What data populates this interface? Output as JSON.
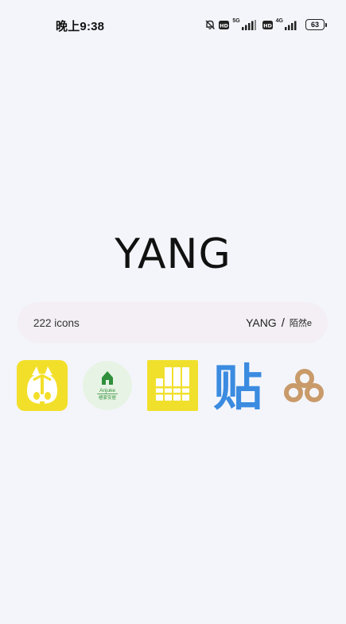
{
  "status_bar": {
    "time": "晚上9:38",
    "network_1": "5G",
    "network_2": "4G",
    "battery": "63",
    "icons": [
      "bell-off-icon",
      "hd-icon",
      "signal-icon",
      "hd-icon",
      "signal-icon",
      "battery-icon"
    ]
  },
  "theme": {
    "title": "YANG",
    "icon_count": "222 icons",
    "author": "YANG",
    "separator": "/",
    "subtitle": "陌然e"
  },
  "preview_icons": [
    {
      "name": "yellow-cat-app-icon",
      "color": "#f2df2a"
    },
    {
      "name": "anjuke-app-icon",
      "label_top": "Anjuke",
      "label_bottom": "極家安居",
      "color": "#2f8f3a"
    },
    {
      "name": "yellow-blocks-app-icon",
      "color": "#f0e02c"
    },
    {
      "name": "tieba-app-icon",
      "glyph": "贴",
      "color": "#3b8be0"
    },
    {
      "name": "baidu-cloud-app-icon",
      "color": "#c99a6a"
    }
  ]
}
